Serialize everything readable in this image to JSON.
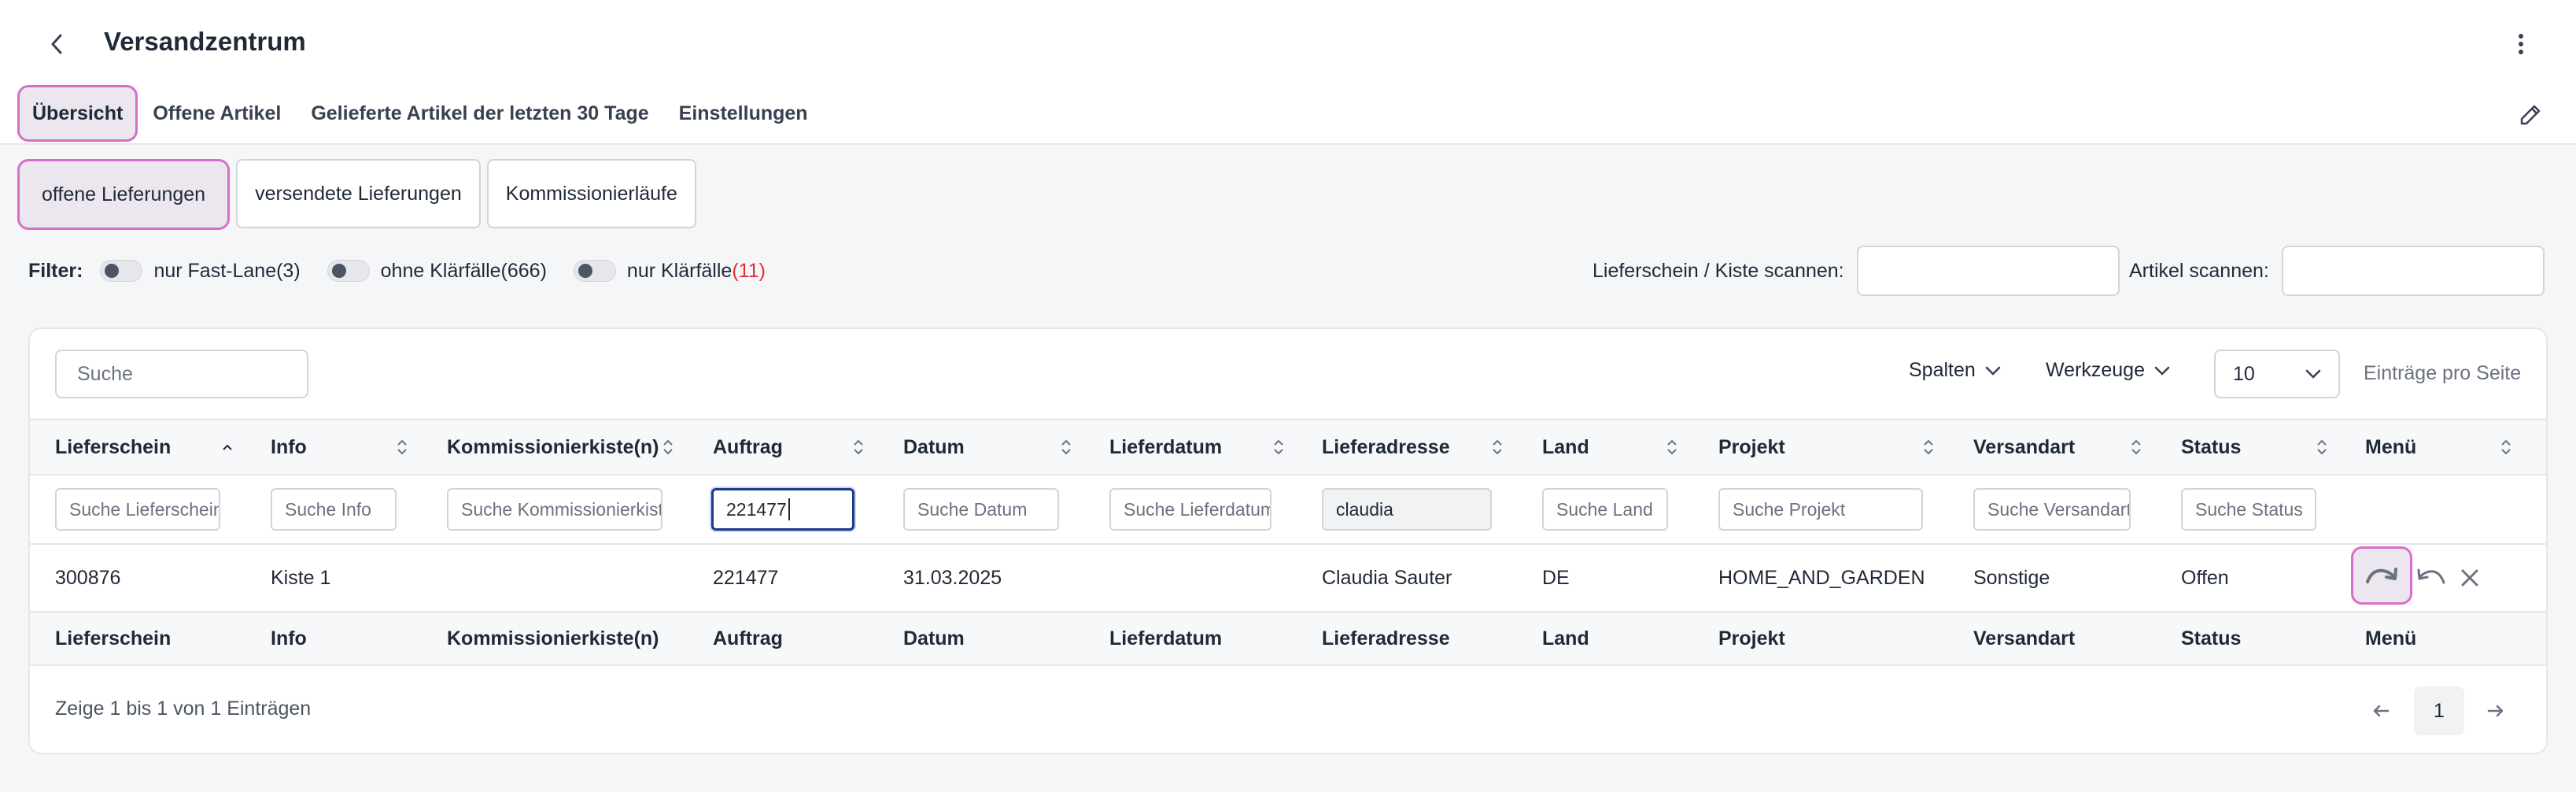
{
  "header": {
    "title": "Versandzentrum",
    "tabs": [
      {
        "label": "Übersicht",
        "active": true
      },
      {
        "label": "Offene Artikel"
      },
      {
        "label": "Gelieferte Artikel der letzten 30 Tage"
      },
      {
        "label": "Einstellungen"
      }
    ]
  },
  "subtabs": [
    {
      "label": "offene Lieferungen",
      "active": true
    },
    {
      "label": "versendete Lieferungen"
    },
    {
      "label": "Kommissionierläufe"
    }
  ],
  "filters": {
    "label": "Filter",
    "colon": ":",
    "items": [
      {
        "label": "nur Fast-Lane",
        "count": "(3)",
        "count_color": "default"
      },
      {
        "label": "ohne Klärfälle",
        "count": "(666)",
        "count_color": "default"
      },
      {
        "label": "nur Klärfälle",
        "count": "(11)",
        "count_color": "#e0312f"
      }
    ]
  },
  "scan": {
    "delivery_label": "Lieferschein / Kiste scannen:",
    "delivery_value": "",
    "article_label": "Artikel scannen:",
    "article_value": ""
  },
  "table": {
    "search_placeholder": "Suche",
    "columns_label": "Spalten",
    "tools_label": "Werkzeuge",
    "page_size": "10",
    "page_size_label": "Einträge pro Seite",
    "columns": [
      "Lieferschein",
      "Info",
      "Kommissionierkiste(n)",
      "Auftrag",
      "Datum",
      "Lieferdatum",
      "Lieferadresse",
      "Land",
      "Projekt",
      "Versandart",
      "Status",
      "Menü"
    ],
    "filters": [
      {
        "placeholder": "Suche Lieferschein",
        "value": ""
      },
      {
        "placeholder": "Suche Info",
        "value": ""
      },
      {
        "placeholder": "Suche Kommissionierkiste",
        "value": ""
      },
      {
        "placeholder": "Suche Auftrag",
        "value": "221477"
      },
      {
        "placeholder": "Suche Datum",
        "value": ""
      },
      {
        "placeholder": "Suche Lieferdatum",
        "value": ""
      },
      {
        "placeholder": "Suche Lieferadresse",
        "value": "claudia"
      },
      {
        "placeholder": "Suche Land",
        "value": ""
      },
      {
        "placeholder": "Suche Projekt",
        "value": ""
      },
      {
        "placeholder": "Suche Versandart",
        "value": ""
      },
      {
        "placeholder": "Suche Status",
        "value": ""
      }
    ],
    "rows": [
      [
        "300876",
        "Kiste 1",
        "",
        "221477",
        "31.03.2025",
        "",
        "Claudia Sauter",
        "DE",
        "HOME_AND_GARDEN",
        "Sonstige",
        "Offen"
      ]
    ],
    "summary": "Zeige 1 bis 1 von 1 Einträgen",
    "current_page": "1"
  },
  "icons": {
    "back": "chevron-left-icon",
    "more": "kebab-vertical-icon",
    "edit": "pencil-icon",
    "sort": "sort-arrows-icon",
    "row_actions": [
      "redo-arrow-icon",
      "undo-arrow-icon",
      "close-icon"
    ],
    "pager": [
      "arrow-left-icon",
      "arrow-right-icon"
    ]
  },
  "colors": {
    "accent_highlight": "#d86ec9",
    "active_bg": "#ece6ee",
    "warning_text": "#e0312f"
  }
}
